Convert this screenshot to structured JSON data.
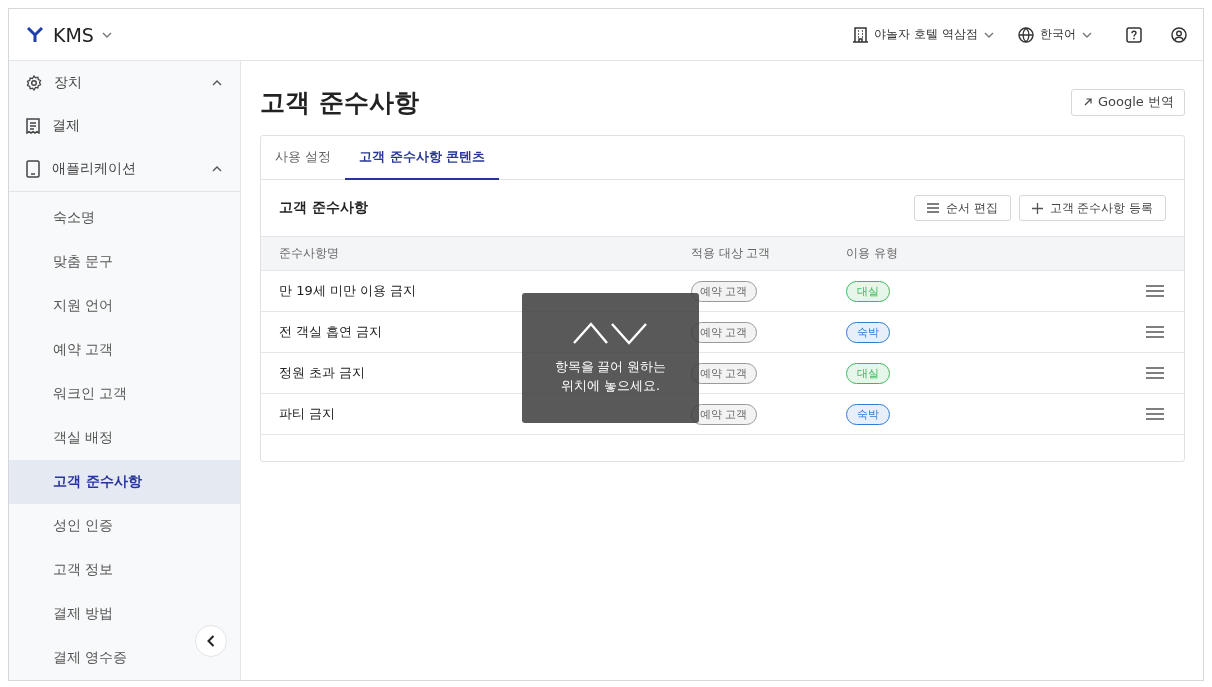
{
  "header": {
    "brand": "KMS",
    "property": "야놀자 호텔 역삼점",
    "language": "한국어"
  },
  "sidebar": {
    "items": [
      {
        "label": "장치",
        "kind": "gear",
        "expanded": true
      },
      {
        "label": "결제",
        "kind": "receipt"
      },
      {
        "label": "애플리케이션",
        "kind": "phone",
        "expanded": true,
        "children": [
          {
            "label": "숙소명",
            "selected": false
          },
          {
            "label": "맞춤 문구",
            "selected": false
          },
          {
            "label": "지원 언어",
            "selected": false
          },
          {
            "label": "예약 고객",
            "selected": false
          },
          {
            "label": "워크인 고객",
            "selected": false
          },
          {
            "label": "객실 배정",
            "selected": false
          },
          {
            "label": "고객 준수사항",
            "selected": true
          },
          {
            "label": "성인 인증",
            "selected": false
          },
          {
            "label": "고객 정보",
            "selected": false
          },
          {
            "label": "결제 방법",
            "selected": false
          },
          {
            "label": "결제 영수증",
            "selected": false
          }
        ]
      }
    ]
  },
  "page": {
    "title": "고객 준수사항",
    "translate_button": "Google 번역"
  },
  "tabs": [
    {
      "label": "사용 설정",
      "selected": false
    },
    {
      "label": "고객 준수사항 콘텐츠",
      "selected": true
    }
  ],
  "section": {
    "title": "고객 준수사항",
    "buttons": [
      {
        "label": "순서 편집",
        "kind": "reorder"
      },
      {
        "label": "고객 준수사항 등록",
        "kind": "add"
      }
    ]
  },
  "table": {
    "columns": [
      "준수사항명",
      "적용 대상 고객",
      "이용 유형"
    ],
    "rows": [
      {
        "name": "만 19세 미만 이용 금지",
        "target": "예약 고객",
        "type": "대실",
        "color": "#3cb95c"
      },
      {
        "name": "전 객실 흡연 금지",
        "target": "예약 고객",
        "type": "숙박",
        "color": "#2f7bd6"
      },
      {
        "name": "정원 초과 금지",
        "target": "예약 고객",
        "type": "대실",
        "color": "#3cb95c"
      },
      {
        "name": "파티 금지",
        "target": "예약 고객",
        "type": "숙박",
        "color": "#2f7bd6"
      }
    ]
  },
  "drag_hint": {
    "text": "항목을 끌어 원하는 위치에 놓으세요."
  }
}
